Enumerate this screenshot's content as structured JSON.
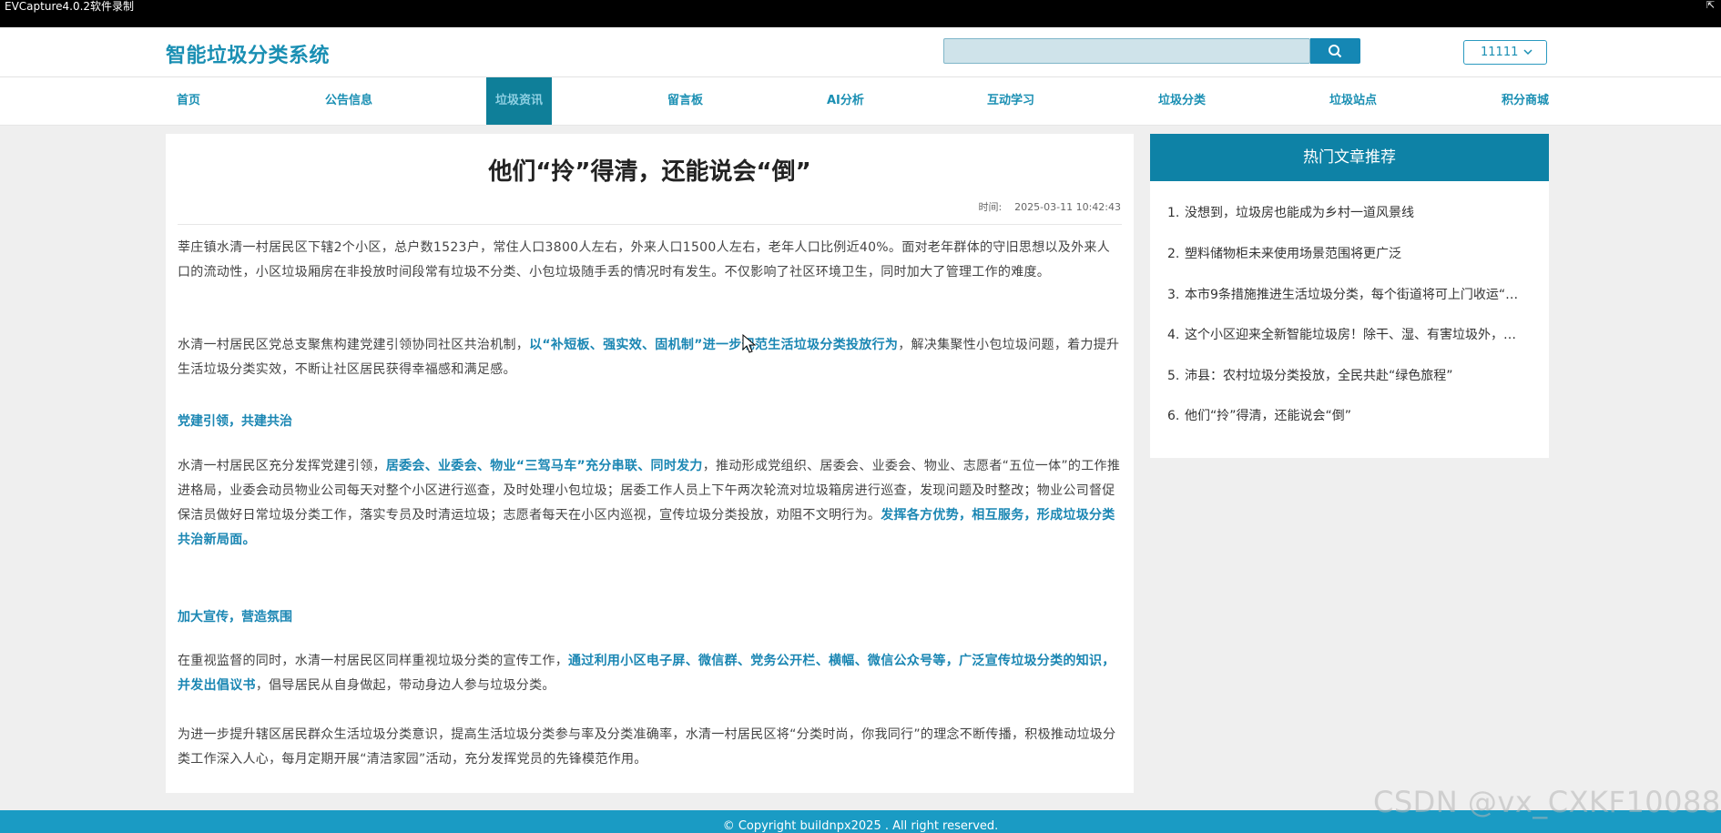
{
  "recorder": {
    "title": "EVCapture4.0.2软件录制"
  },
  "header": {
    "logo": "智能垃圾分类系统",
    "search": {
      "value": "",
      "placeholder": ""
    },
    "user": {
      "name": "11111"
    }
  },
  "nav": {
    "items": [
      "首页",
      "公告信息",
      "垃圾资讯",
      "留言板",
      "AI分析",
      "互动学习",
      "垃圾分类",
      "垃圾站点",
      "积分商城"
    ],
    "active": "垃圾资讯"
  },
  "article": {
    "title": "他们“拎”得清，还能说会“倒”",
    "time_label": "时间:",
    "time_value": "2025-03-11 10:42:43",
    "p1": "莘庄镇水清一村居民区下辖2个小区，总户数1523户，常住人口3800人左右，外来人口1500人左右，老年人口比例近40%。面对老年群体的守旧思想以及外来人口的流动性，小区垃圾厢房在非投放时间段常有垃圾不分类、小包垃圾随手丢的情况时有发生。不仅影响了社区环境卫生，同时加大了管理工作的难度。",
    "p2_a": "水清一村居民区党总支聚焦构建党建引领协同社区共治机制，",
    "p2_b": "以“补短板、强实效、固机制”进一步规范生活垃圾分类投放行为",
    "p2_c": "，解决集聚性小包垃圾问题，着力提升生活垃圾分类实效，不断让社区居民获得幸福感和满足感。",
    "h1": "党建引领，共建共治",
    "p3_a": "水清一村居民区充分发挥党建引领，",
    "p3_b": "居委会、业委会、物业“三驾马车”充分串联、同时发力",
    "p3_c": "，推动形成党组织、居委会、业委会、物业、志愿者“五位一体”的工作推进格局，业委会动员物业公司每天对整个小区进行巡查，及时处理小包垃圾；居委工作人员上下午两次轮流对垃圾箱房进行巡查，发现问题及时整改；物业公司督促保洁员做好日常垃圾分类工作，落实专员及时清运垃圾；志愿者每天在小区内巡视，宣传垃圾分类投放，劝阻不文明行为。",
    "p3_d": "发挥各方优势，相互服务，形成垃圾分类共治新局面。",
    "h2": "加大宣传，营造氛围",
    "p4_a": "在重视监督的同时，水清一村居民区同样重视垃圾分类的宣传工作，",
    "p4_b": "通过利用小区电子屏、微信群、党务公开栏、横幅、微信公众号等，广泛宣传垃圾分类的知识，并发出倡议书",
    "p4_c": "，倡导居民从自身做起，带动身边人参与垃圾分类。",
    "p5": "为进一步提升辖区居民群众生活垃圾分类意识，提高生活垃圾分类参与率及分类准确率，水清一村居民区将“分类时尚，你我同行”的理念不断传播，积极推动垃圾分类工作深入人心，每月定期开展“清洁家园”活动，充分发挥党员的先锋模范作用。"
  },
  "sidebar": {
    "title": "热门文章推荐",
    "items": [
      "没想到，垃圾房也能成为乡村一道风景线",
      "塑料储物柜未来使用场景范围将更广泛",
      "本市9条措施推进生活垃圾分类，每个街道将可上门收运“…",
      "这个小区迎来全新智能垃圾房！除干、湿、有害垃圾外，…",
      "沛县：农村垃圾分类投放，全民共赴“绿色旅程”",
      "他们“拎”得清，还能说会“倒”"
    ]
  },
  "footer": {
    "text": "© Copyright buildnpx2025 . All right reserved."
  },
  "watermark": "CSDN @vx_CXKF10088",
  "colors": {
    "accent": "#1a8fb3",
    "nav_active": "#0f7f99",
    "sidebar_head": "#0e82a6",
    "footer": "#1a9bc4"
  }
}
